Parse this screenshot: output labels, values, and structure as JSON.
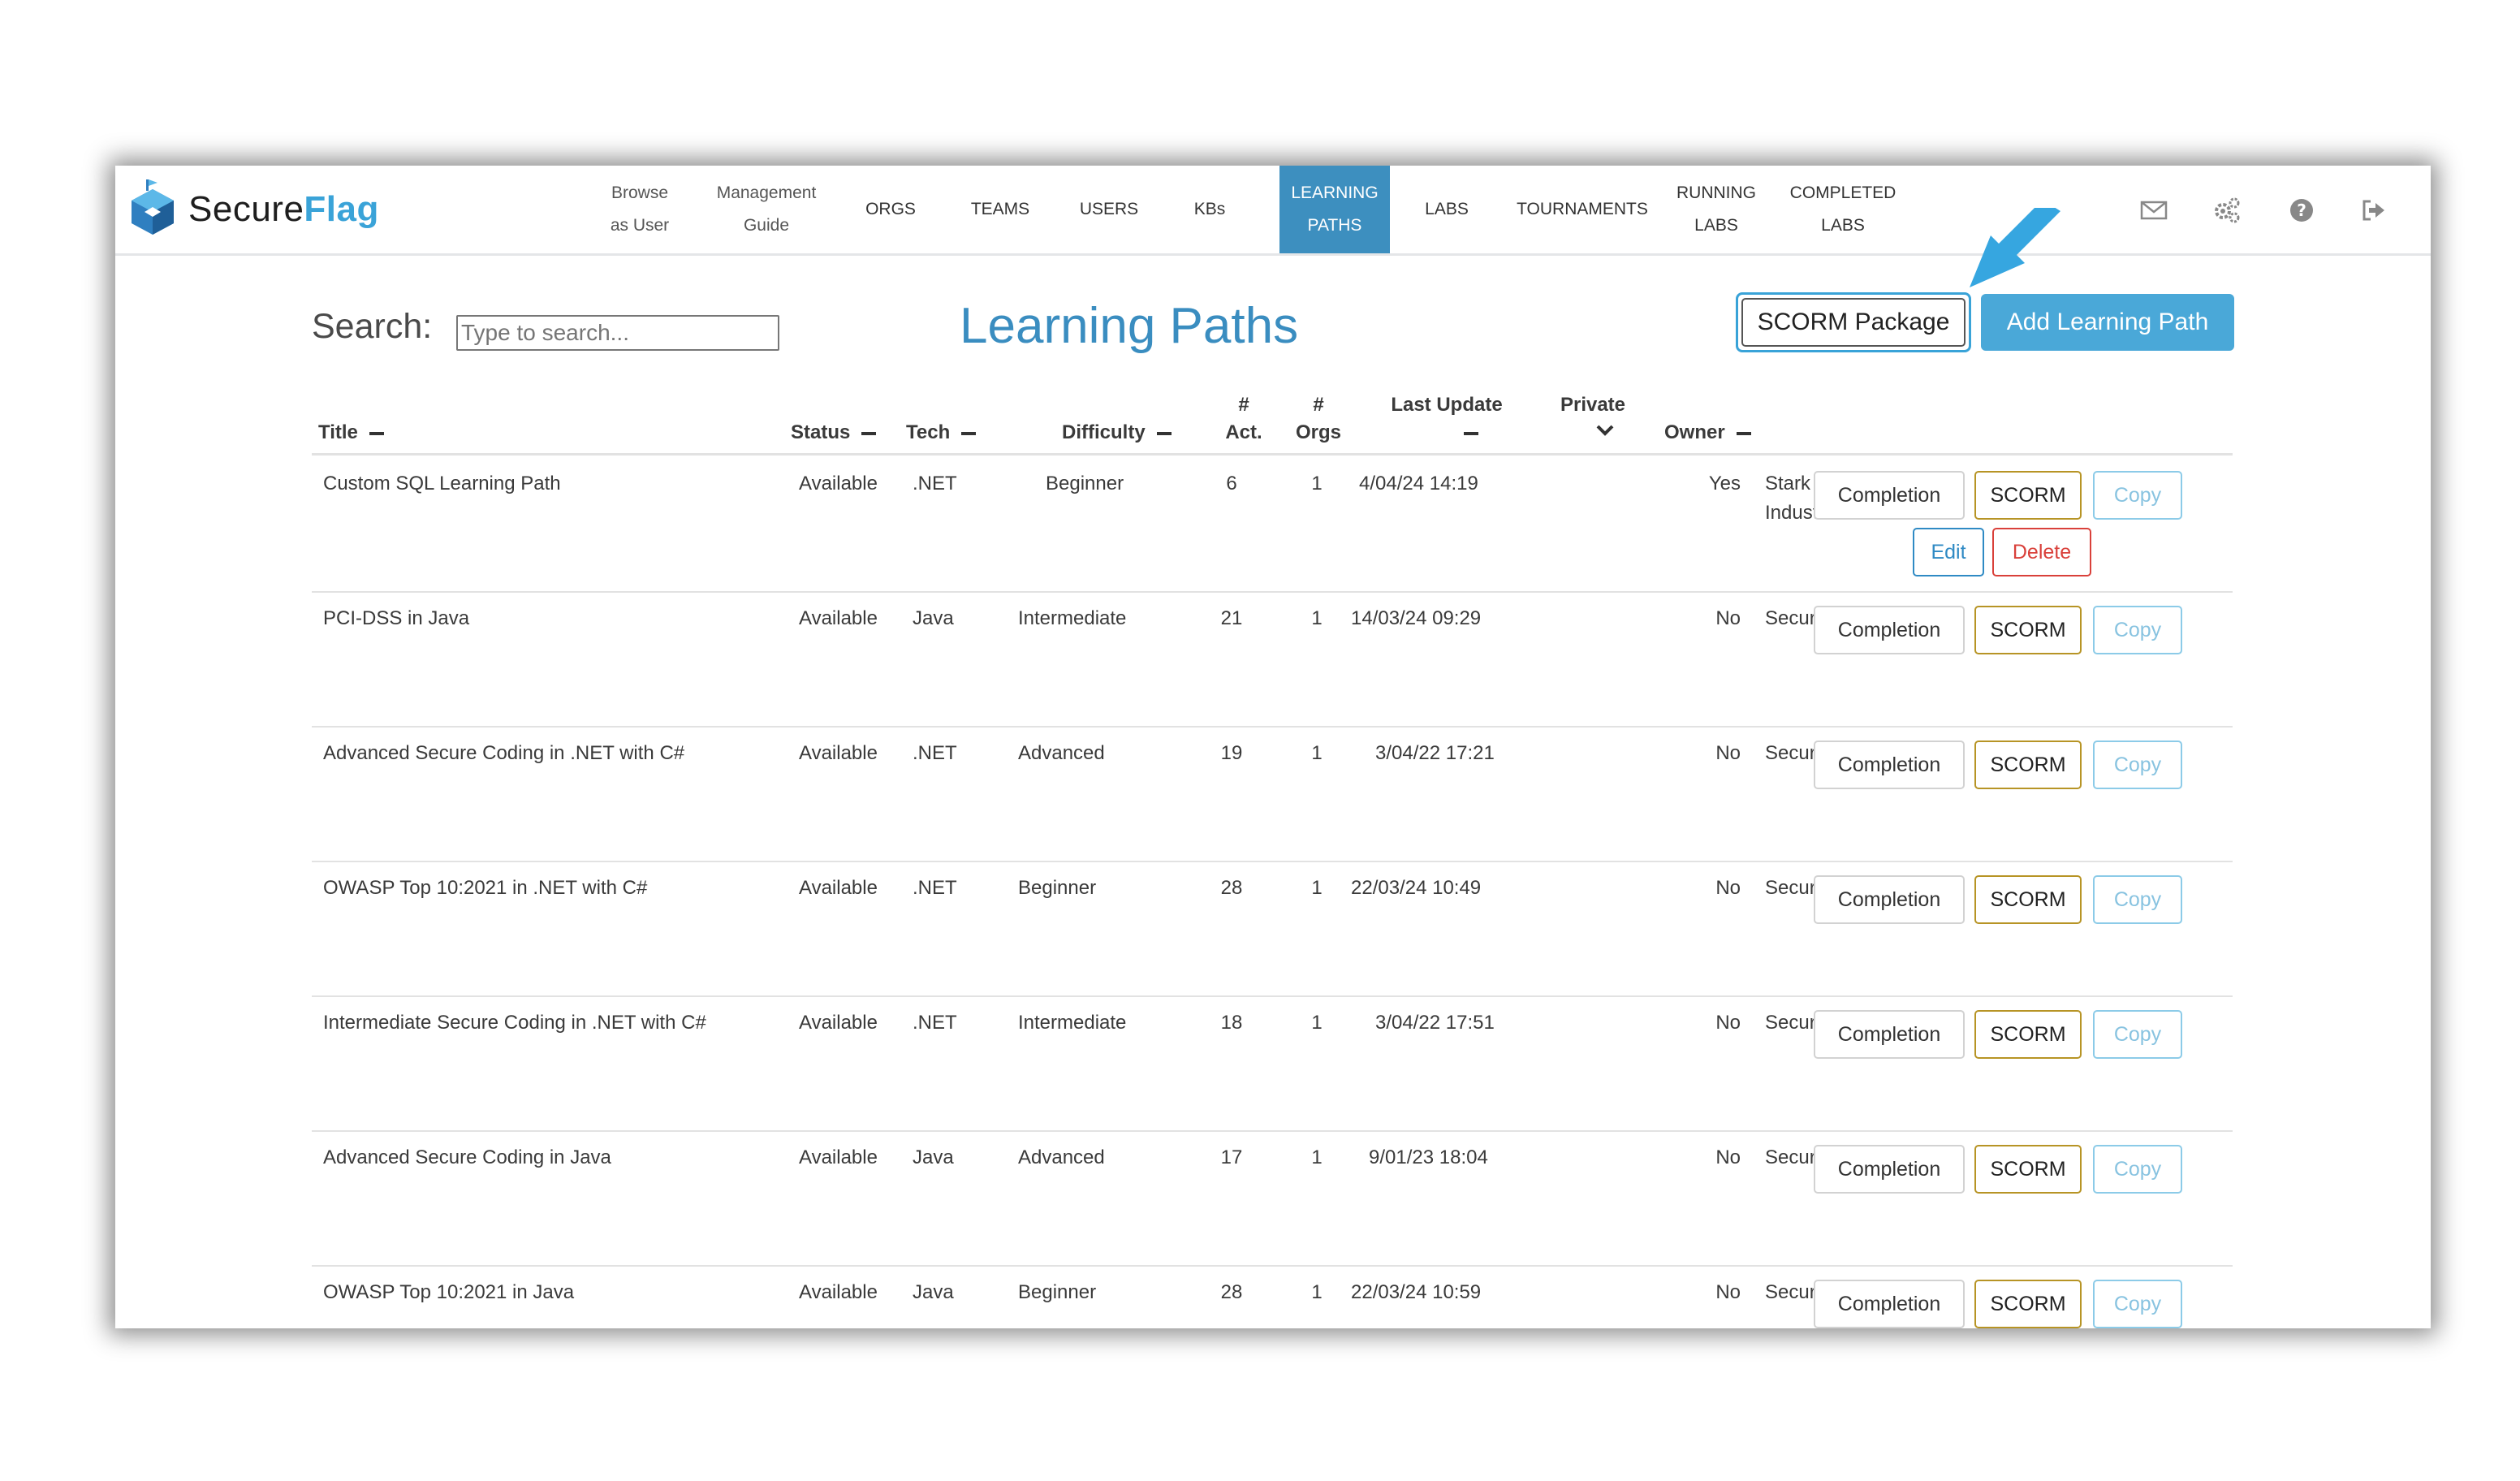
{
  "brand": {
    "name_part1": "Secure",
    "name_part2": "Flag"
  },
  "nav": [
    {
      "label": "Browse\nas User",
      "style": "small"
    },
    {
      "label": "Management\nGuide",
      "style": "small"
    },
    {
      "label": "ORGS"
    },
    {
      "label": "TEAMS"
    },
    {
      "label": "USERS"
    },
    {
      "label": "KBs"
    },
    {
      "label": "LEARNING\nPATHS",
      "active": true
    },
    {
      "label": "LABS"
    },
    {
      "label": "TOURNAMENTS"
    },
    {
      "label": "RUNNING\nLABS"
    },
    {
      "label": "COMPLETED\nLABS"
    }
  ],
  "header_icons": [
    "mail-icon",
    "settings-gears-icon",
    "help-icon",
    "logout-icon"
  ],
  "search": {
    "label": "Search:",
    "placeholder": "Type to search..."
  },
  "page_title": "Learning Paths",
  "actions": {
    "scorm_package": "SCORM Package",
    "add_learning_path": "Add Learning Path"
  },
  "table": {
    "columns": {
      "title": "Title",
      "status": "Status",
      "tech": "Tech",
      "difficulty": "Difficulty",
      "act_1": "#",
      "act_2": "Act.",
      "orgs_1": "#",
      "orgs_2": "Orgs",
      "last_update": "Last Update",
      "private": "Private",
      "owner": "Owner"
    },
    "row_buttons": {
      "completion": "Completion",
      "scorm": "SCORM",
      "copy": "Copy",
      "edit": "Edit",
      "delete": "Delete"
    },
    "rows": [
      {
        "title": "Custom SQL Learning Path",
        "status": "Available",
        "tech": ".NET",
        "difficulty": "Beginner",
        "act": "6",
        "orgs": "1",
        "last_update": "4/04/24 14:19",
        "private": "Yes",
        "owner": "Stark\nIndustries",
        "editable": true
      },
      {
        "title": "PCI-DSS in Java",
        "status": "Available",
        "tech": "Java",
        "difficulty": "Intermediate",
        "act": "21",
        "orgs": "1",
        "last_update": "14/03/24 09:29",
        "private": "No",
        "owner": "SecureFlag"
      },
      {
        "title": "Advanced Secure Coding in .NET with C#",
        "status": "Available",
        "tech": ".NET",
        "difficulty": "Advanced",
        "act": "19",
        "orgs": "1",
        "last_update": "3/04/22 17:21",
        "private": "No",
        "owner": "SecureFlag"
      },
      {
        "title": "OWASP Top 10:2021 in .NET with C#",
        "status": "Available",
        "tech": ".NET",
        "difficulty": "Beginner",
        "act": "28",
        "orgs": "1",
        "last_update": "22/03/24 10:49",
        "private": "No",
        "owner": "SecureFlag"
      },
      {
        "title": "Intermediate Secure Coding in .NET with C#",
        "status": "Available",
        "tech": ".NET",
        "difficulty": "Intermediate",
        "act": "18",
        "orgs": "1",
        "last_update": "3/04/22 17:51",
        "private": "No",
        "owner": "SecureFlag"
      },
      {
        "title": "Advanced Secure Coding in Java",
        "status": "Available",
        "tech": "Java",
        "difficulty": "Advanced",
        "act": "17",
        "orgs": "1",
        "last_update": "9/01/23 18:04",
        "private": "No",
        "owner": "SecureFlag"
      },
      {
        "title": "OWASP Top 10:2021 in Java",
        "status": "Available",
        "tech": "Java",
        "difficulty": "Beginner",
        "act": "28",
        "orgs": "1",
        "last_update": "22/03/24 10:59",
        "private": "No",
        "owner": "SecureFlag"
      }
    ]
  },
  "colors": {
    "accent": "#3a8dc0",
    "nav_active": "#3d8fbf",
    "add_button": "#4aa8d8",
    "scorm_border": "#b79425",
    "delete": "#d9403a"
  }
}
